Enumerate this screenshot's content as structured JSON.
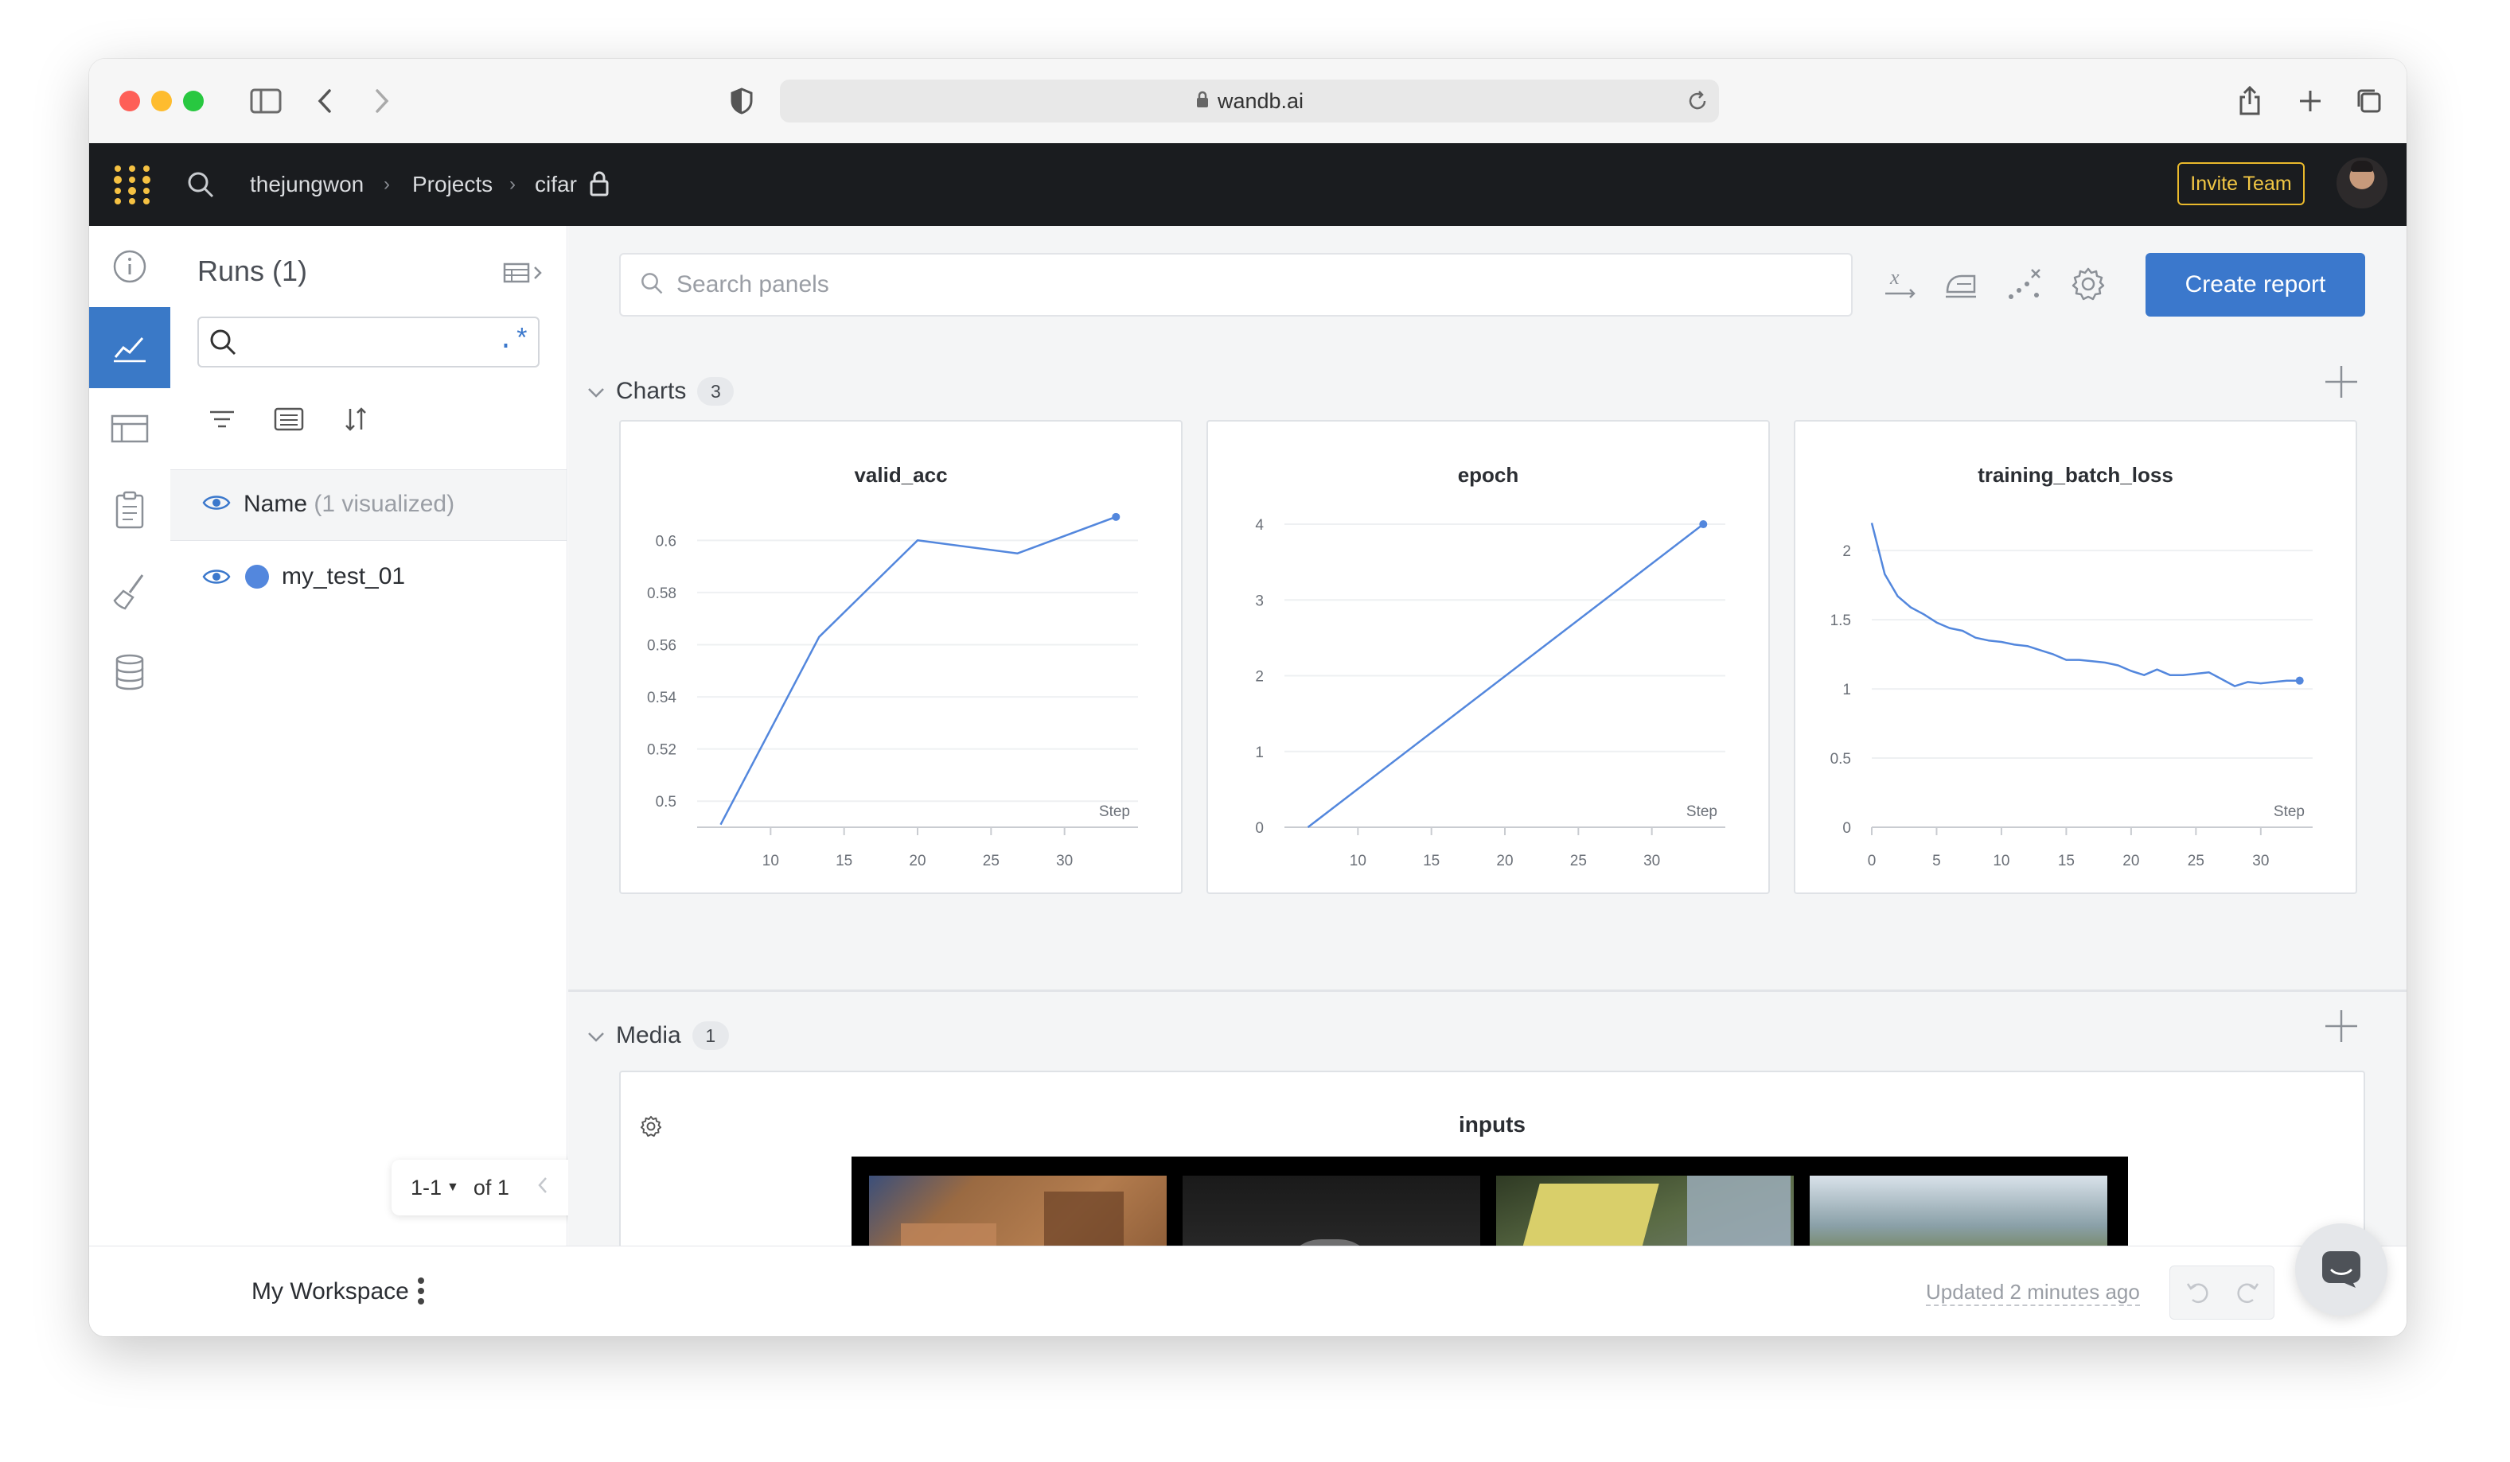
{
  "browser": {
    "url": "wandb.ai"
  },
  "header": {
    "breadcrumb": [
      "thejungwon",
      "Projects",
      "cifar"
    ],
    "invite_label": "Invite Team"
  },
  "runs": {
    "title": "Runs (1)",
    "search_regex_label": ".*",
    "column_name": "Name",
    "column_note": "(1 visualized)",
    "items": [
      {
        "name": "my_test_01",
        "color": "#5387dd"
      }
    ],
    "pager": {
      "range": "1-1",
      "of": "of 1"
    }
  },
  "main": {
    "search_placeholder": "Search panels",
    "create_report_label": "Create report",
    "charts_section": {
      "title": "Charts",
      "count": "3"
    },
    "media_section": {
      "title": "Media",
      "count": "1",
      "panel_title": "inputs"
    }
  },
  "chart_data": [
    {
      "type": "line",
      "title": "valid_acc",
      "xlabel": "Step",
      "xlim": [
        5,
        35
      ],
      "ylim": [
        0.49,
        0.612
      ],
      "xticks": [
        10,
        15,
        20,
        25,
        30
      ],
      "yticks": [
        0.5,
        0.52,
        0.54,
        0.56,
        0.58,
        0.6
      ],
      "ytick_labels": [
        "0.5",
        "0.52",
        "0.54",
        "0.56",
        "0.58",
        "0.6"
      ],
      "color": "#5387dd",
      "x": [
        6.6,
        13.3,
        20,
        26.8,
        33.5
      ],
      "y": [
        0.491,
        0.563,
        0.6,
        0.595,
        0.609
      ]
    },
    {
      "type": "line",
      "title": "epoch",
      "xlabel": "Step",
      "xlim": [
        5,
        35
      ],
      "ylim": [
        0,
        4.2
      ],
      "xticks": [
        10,
        15,
        20,
        25,
        30
      ],
      "yticks": [
        0,
        1,
        2,
        3,
        4
      ],
      "ytick_labels": [
        "0",
        "1",
        "2",
        "3",
        "4"
      ],
      "color": "#5387dd",
      "x": [
        6.6,
        33.5
      ],
      "y": [
        0,
        4
      ]
    },
    {
      "type": "line",
      "title": "training_batch_loss",
      "xlabel": "Step",
      "xlim": [
        0,
        34
      ],
      "ylim": [
        0,
        2.3
      ],
      "xticks": [
        0,
        5,
        10,
        15,
        20,
        25,
        30
      ],
      "yticks": [
        0,
        0.5,
        1,
        1.5,
        2
      ],
      "ytick_labels": [
        "0",
        "0.5",
        "1",
        "1.5",
        "2"
      ],
      "color": "#5387dd",
      "x": [
        0,
        1,
        2,
        3,
        4,
        5,
        6,
        7,
        8,
        9,
        10,
        11,
        12,
        13,
        14,
        15,
        16,
        17,
        18,
        19,
        20,
        21,
        22,
        23,
        24,
        25,
        26,
        27,
        28,
        29,
        30,
        31,
        32,
        33
      ],
      "y": [
        2.2,
        1.83,
        1.67,
        1.59,
        1.54,
        1.48,
        1.44,
        1.42,
        1.37,
        1.35,
        1.34,
        1.32,
        1.31,
        1.28,
        1.25,
        1.21,
        1.21,
        1.2,
        1.19,
        1.17,
        1.13,
        1.1,
        1.14,
        1.1,
        1.1,
        1.11,
        1.12,
        1.07,
        1.02,
        1.05,
        1.04,
        1.05,
        1.06,
        1.06
      ]
    }
  ],
  "footer": {
    "workspace_label": "My Workspace",
    "updated_label": "Updated 2 minutes ago"
  }
}
